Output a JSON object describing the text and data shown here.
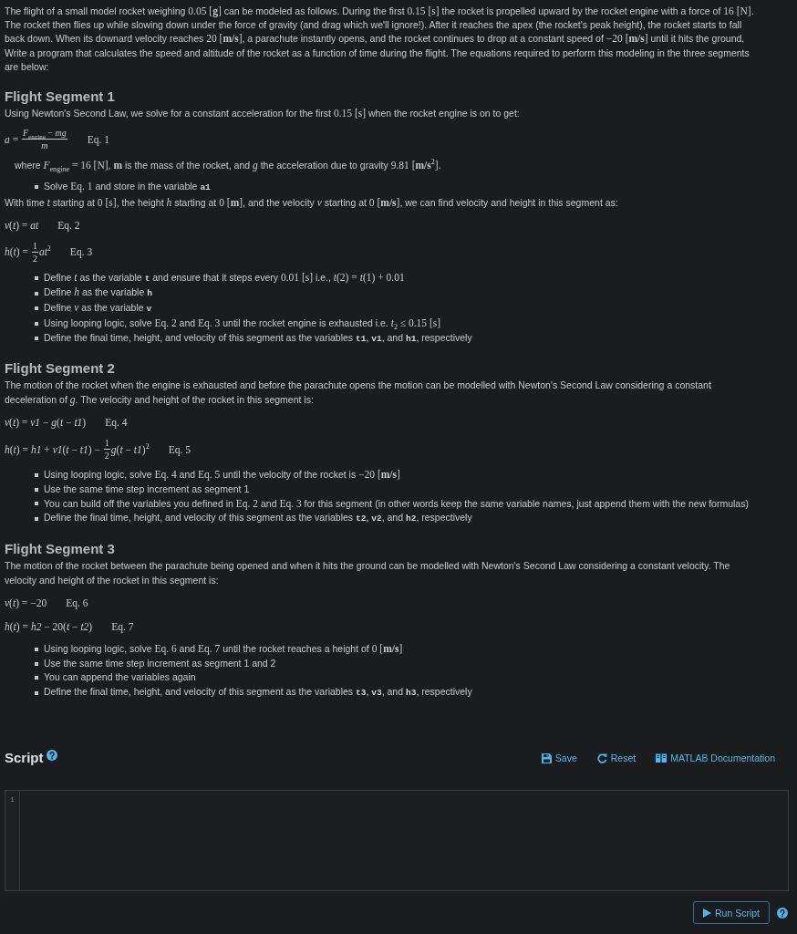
{
  "intro": [
    {
      "kind": "text",
      "text": "The flight of a small model rocket weighing "
    },
    {
      "kind": "math",
      "text": "0.05 [**g**]"
    },
    {
      "kind": "text",
      "text": " can be modeled as follows. During the first "
    },
    {
      "kind": "math",
      "text": "0.15 [s]"
    },
    {
      "kind": "text",
      "text": " the rocket is propelled upward by the rocket engine with a force of "
    },
    {
      "kind": "math",
      "text": "16 [N]"
    },
    {
      "kind": "text",
      "text": ". The rocket then flies up while slowing down under the force of gravity (and drag which we'll ignore!). After it reaches the apex (the rocket's peak height), the rocket starts to fall back down. When its downard velocity reaches "
    },
    {
      "kind": "math",
      "text": "20 [**m/s**]"
    },
    {
      "kind": "text",
      "text": ", a parachute instantly opens, and the rocket continues to drop at a constant speed of "
    },
    {
      "kind": "math",
      "text": "−20 [**m/s**]"
    },
    {
      "kind": "text",
      "text": " until it hits the ground. Write a program that calculates the speed and altitude of the rocket as a function of time during the flight. The equations required to perform this modeling in the three segments are below:"
    }
  ],
  "segments": [
    {
      "title": "Flight Segment 1",
      "blocks": [
        {
          "kind": "paragraph",
          "runs": [
            {
              "kind": "text",
              "text": "Using Newton's Second Law, we solve for a constant acceleration for the first "
            },
            {
              "kind": "math",
              "text": "0.15 [s]"
            },
            {
              "kind": "text",
              "text": " when the rocket engine is on to get:"
            }
          ]
        },
        {
          "kind": "equation",
          "parts": [
            {
              "kind": "math",
              "text": "*a* = "
            },
            {
              "kind": "frac",
              "num": "*F*$_{engine}$ − *mg*",
              "den": "*m*"
            }
          ],
          "label": "Eq. 1"
        },
        {
          "kind": "note",
          "runs": [
            {
              "kind": "text",
              "text": "where "
            },
            {
              "kind": "math",
              "text": "*F*$_{engine}$ = 16 [N]"
            },
            {
              "kind": "text",
              "text": ", "
            },
            {
              "kind": "math",
              "text": "**m**"
            },
            {
              "kind": "text",
              "text": " is the mass of the rocket, and "
            },
            {
              "kind": "math",
              "text": "*g*"
            },
            {
              "kind": "text",
              "text": " the acceleration due to gravity "
            },
            {
              "kind": "math",
              "text": "9.81 [**m/s**$^{2}$]"
            },
            {
              "kind": "text",
              "text": "."
            }
          ]
        },
        {
          "kind": "bullets",
          "items": [
            [
              {
                "kind": "text",
                "text": "Solve "
              },
              {
                "kind": "math",
                "text": "Eq. 1"
              },
              {
                "kind": "text",
                "text": " and store in the variable "
              },
              {
                "kind": "code",
                "text": "a1"
              }
            ]
          ]
        },
        {
          "kind": "paragraph",
          "runs": [
            {
              "kind": "text",
              "text": "With time "
            },
            {
              "kind": "math",
              "text": "*t*"
            },
            {
              "kind": "text",
              "text": " starting at "
            },
            {
              "kind": "math",
              "text": "0 [s]"
            },
            {
              "kind": "text",
              "text": ", the height "
            },
            {
              "kind": "math",
              "text": "*h*"
            },
            {
              "kind": "text",
              "text": " starting at "
            },
            {
              "kind": "math",
              "text": "0 [**m**]"
            },
            {
              "kind": "text",
              "text": ", and the velocity "
            },
            {
              "kind": "math",
              "text": "*v*"
            },
            {
              "kind": "text",
              "text": " starting at "
            },
            {
              "kind": "math",
              "text": "0 [**m/s**]"
            },
            {
              "kind": "text",
              "text": ", we can find velocity and height in this segment as:"
            }
          ]
        },
        {
          "kind": "equation",
          "parts": [
            {
              "kind": "math",
              "text": "*v*(*t*) = *at*"
            }
          ],
          "label": "Eq. 2"
        },
        {
          "kind": "equation",
          "parts": [
            {
              "kind": "math",
              "text": "*h*(*t*) = "
            },
            {
              "kind": "frac",
              "num": "1",
              "den": "2"
            },
            {
              "kind": "math",
              "text": "*at*$^{2}$"
            }
          ],
          "label": "Eq. 3"
        },
        {
          "kind": "bullets",
          "items": [
            [
              {
                "kind": "text",
                "text": "Define "
              },
              {
                "kind": "math",
                "text": "*t*"
              },
              {
                "kind": "text",
                "text": " as the variable "
              },
              {
                "kind": "code",
                "text": "t"
              },
              {
                "kind": "text",
                "text": " and ensure that it steps every "
              },
              {
                "kind": "math",
                "text": "0.01 [s]"
              },
              {
                "kind": "text",
                "text": " i.e., "
              },
              {
                "kind": "math",
                "text": "*t*(2) = *t*(1) + 0.01"
              }
            ],
            [
              {
                "kind": "text",
                "text": "Define "
              },
              {
                "kind": "math",
                "text": "*h*"
              },
              {
                "kind": "text",
                "text": " as the variable "
              },
              {
                "kind": "code",
                "text": "h"
              }
            ],
            [
              {
                "kind": "text",
                "text": "Define "
              },
              {
                "kind": "math",
                "text": "*v*"
              },
              {
                "kind": "text",
                "text": " as the variable "
              },
              {
                "kind": "code",
                "text": "v"
              }
            ],
            [
              {
                "kind": "text",
                "text": "Using looping logic, solve "
              },
              {
                "kind": "math",
                "text": "Eq. 2"
              },
              {
                "kind": "text",
                "text": " and "
              },
              {
                "kind": "math",
                "text": "Eq. 3"
              },
              {
                "kind": "text",
                "text": " until the rocket engine is exhausted i.e. "
              },
              {
                "kind": "math",
                "text": "*t*$_{2}$ ≤ 0.15 [s]"
              }
            ],
            [
              {
                "kind": "text",
                "text": "Define the final time, height, and velocity of this segment as the variables "
              },
              {
                "kind": "code",
                "text": "t1"
              },
              {
                "kind": "text",
                "text": ", "
              },
              {
                "kind": "code",
                "text": "v1"
              },
              {
                "kind": "text",
                "text": ", and "
              },
              {
                "kind": "code",
                "text": "h1"
              },
              {
                "kind": "text",
                "text": ", respectively"
              }
            ]
          ]
        }
      ]
    },
    {
      "title": "Flight Segment 2",
      "blocks": [
        {
          "kind": "paragraph",
          "runs": [
            {
              "kind": "text",
              "text": "The motion of the rocket when the engine is exhausted and before the parachute opens the motion can be modelled with Newton's Second Law considering a constant deceleration of "
            },
            {
              "kind": "math",
              "text": "*g*"
            },
            {
              "kind": "text",
              "text": ". The velocity and height of the rocket in this segment is:"
            }
          ]
        },
        {
          "kind": "equation",
          "parts": [
            {
              "kind": "math",
              "text": "*v*(*t*) = *v1* − *g*(*t* − *t1*)"
            }
          ],
          "label": "Eq. 4"
        },
        {
          "kind": "equation",
          "parts": [
            {
              "kind": "math",
              "text": "*h*(*t*) = *h1* + *v1*(*t* − *t1*) − "
            },
            {
              "kind": "frac",
              "num": "1",
              "den": "2"
            },
            {
              "kind": "math",
              "text": "*g*(*t* − *t1*)$^{2}$"
            }
          ],
          "label": "Eq. 5"
        },
        {
          "kind": "bullets",
          "items": [
            [
              {
                "kind": "text",
                "text": "Using looping logic, solve "
              },
              {
                "kind": "math",
                "text": "Eq. 4"
              },
              {
                "kind": "text",
                "text": " and "
              },
              {
                "kind": "math",
                "text": "Eq. 5"
              },
              {
                "kind": "text",
                "text": " until the velocity of the rocket is "
              },
              {
                "kind": "math",
                "text": "−20 [**m/s**]"
              }
            ],
            [
              {
                "kind": "text",
                "text": "Use the same time step increment as segment 1"
              }
            ],
            [
              {
                "kind": "text",
                "text": "You can build off the variables you defined in "
              },
              {
                "kind": "math",
                "text": "Eq. 2"
              },
              {
                "kind": "text",
                "text": " and "
              },
              {
                "kind": "math",
                "text": "Eq. 3"
              },
              {
                "kind": "text",
                "text": " for this segment (in other words keep the same variable names, just append them with the new formulas)"
              }
            ],
            [
              {
                "kind": "text",
                "text": "Define the final time, height, and velocity of this segment as the variables "
              },
              {
                "kind": "code",
                "text": "t2"
              },
              {
                "kind": "text",
                "text": ", "
              },
              {
                "kind": "code",
                "text": "v2"
              },
              {
                "kind": "text",
                "text": ", and "
              },
              {
                "kind": "code",
                "text": "h2"
              },
              {
                "kind": "text",
                "text": ", respectively"
              }
            ]
          ]
        }
      ]
    },
    {
      "title": "Flight Segment 3",
      "blocks": [
        {
          "kind": "paragraph",
          "runs": [
            {
              "kind": "text",
              "text": "The motion of the rocket between the parachute being opened and when it hits the ground can be modelled with Newton's Second Law considering a constant velocity. The velocity and height of the rocket in this segment is:"
            }
          ]
        },
        {
          "kind": "equation",
          "parts": [
            {
              "kind": "math",
              "text": "*v*(*t*) = −20"
            }
          ],
          "label": "Eq. 6"
        },
        {
          "kind": "equation",
          "parts": [
            {
              "kind": "math",
              "text": "*h*(*t*) = *h2* − 20(*t* − *t2*)"
            }
          ],
          "label": "Eq. 7"
        },
        {
          "kind": "bullets",
          "items": [
            [
              {
                "kind": "text",
                "text": "Using looping logic, solve "
              },
              {
                "kind": "math",
                "text": "Eq. 6"
              },
              {
                "kind": "text",
                "text": " and "
              },
              {
                "kind": "math",
                "text": "Eq. 7"
              },
              {
                "kind": "text",
                "text": " until the rocket reaches a height of "
              },
              {
                "kind": "math",
                "text": "0 [**m/s**]"
              }
            ],
            [
              {
                "kind": "text",
                "text": "Use the same time step increment as segment 1 and 2"
              }
            ],
            [
              {
                "kind": "text",
                "text": "You can append the variables again"
              }
            ],
            [
              {
                "kind": "text",
                "text": "Define the final time, height, and velocity of this segment as the variables "
              },
              {
                "kind": "code",
                "text": "t3"
              },
              {
                "kind": "text",
                "text": ", "
              },
              {
                "kind": "code",
                "text": "v3"
              },
              {
                "kind": "text",
                "text": ", and "
              },
              {
                "kind": "code",
                "text": "h3"
              },
              {
                "kind": "text",
                "text": ", respectively"
              }
            ]
          ]
        }
      ]
    }
  ],
  "script": {
    "title": "Script",
    "actions": [
      {
        "kind": "save",
        "label": "Save"
      },
      {
        "kind": "reset",
        "label": "Reset"
      },
      {
        "kind": "docs",
        "label": "MATLAB Documentation"
      }
    ],
    "editor": {
      "line_numbers": [
        "1"
      ]
    },
    "run_button": {
      "label": "Run Script"
    }
  }
}
